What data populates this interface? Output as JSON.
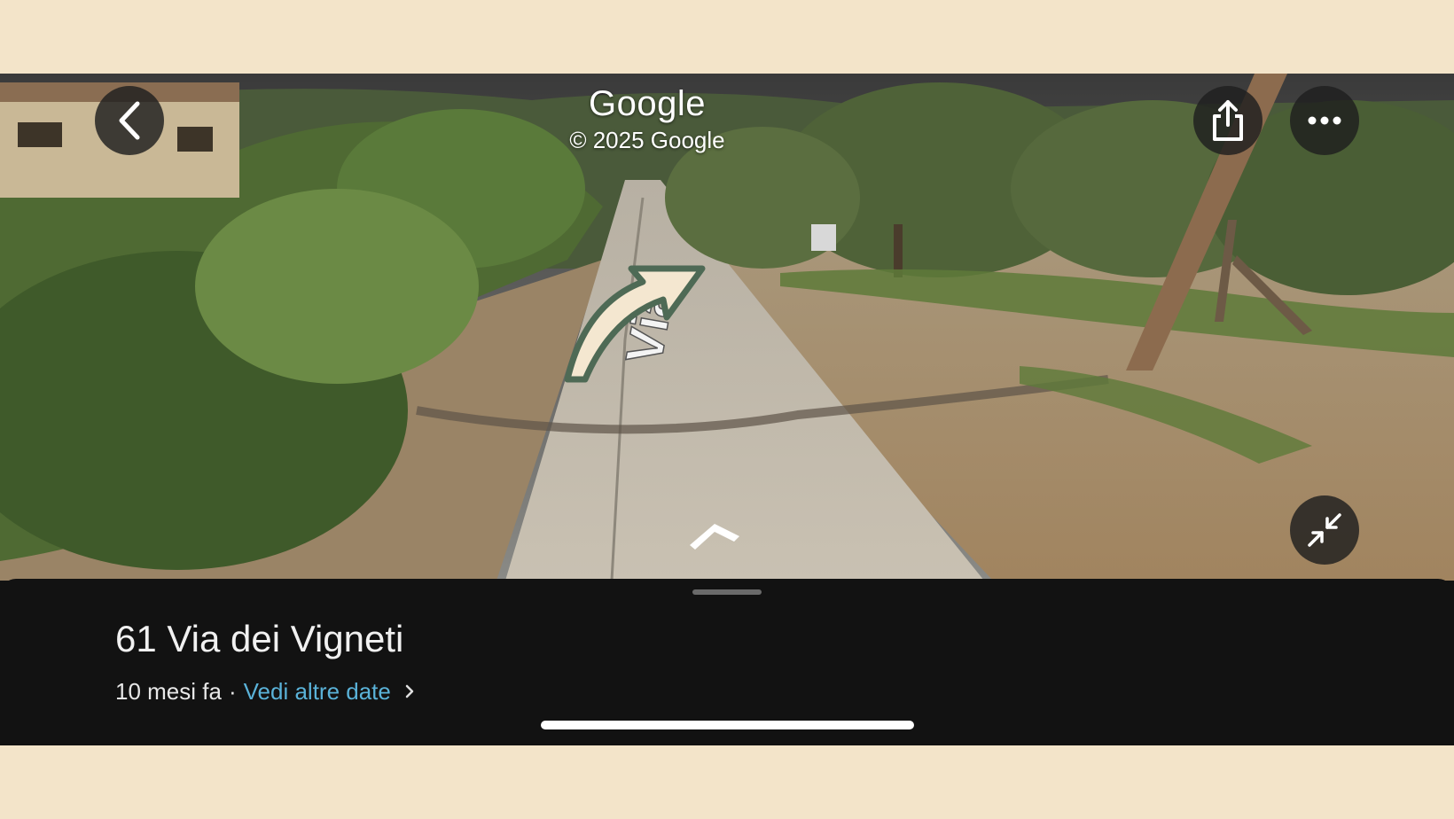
{
  "header": {
    "brand": "Google",
    "copyright": "© 2025 Google"
  },
  "buttons": {
    "back": "back-icon",
    "share": "share-icon",
    "more": "more-horizontal-icon",
    "exit_fullscreen": "collapse-icon"
  },
  "street_view": {
    "road_marking": "Via",
    "nav_arrow": "chevron-up-icon"
  },
  "sheet": {
    "title": "61 Via dei Vigneti",
    "age": "10 mesi fa",
    "separator": "·",
    "more_dates": "Vedi altre date"
  },
  "colors": {
    "link": "#5ab2d8",
    "sheet_bg": "#121212",
    "frame_bg": "#f3e4c9",
    "annotation_arrow": "#f4e7d0"
  }
}
